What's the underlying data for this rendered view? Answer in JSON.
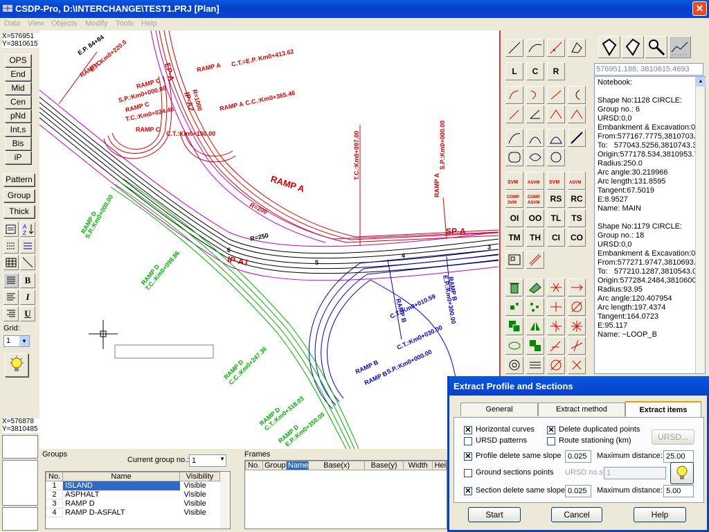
{
  "title": "CSDP-Pro, D:\\INTERCHANGE\\TEST1.PRJ [Plan]",
  "menu": [
    "Data",
    "View",
    "Objects",
    "Modify",
    "Tools",
    "Help"
  ],
  "coords_top": {
    "x": "X=576951",
    "y": "Y=3810615"
  },
  "coords_bottom": {
    "x": "X=576878",
    "y": "Y=3810485"
  },
  "snap_buttons": [
    "OPS",
    "End",
    "Mid",
    "Cen",
    "pNd",
    "Int,s",
    "Bis",
    "iP"
  ],
  "other_buttons": [
    "Pattern",
    "Group",
    "Thick"
  ],
  "grid": {
    "label": "Grid:",
    "value": "1"
  },
  "toolbar_text": [
    "L",
    "C",
    "R",
    "RS",
    "RC",
    "OI",
    "OO",
    "TL",
    "TS",
    "TM",
    "TH",
    "CI",
    "CO"
  ],
  "cursor_coords": "576951.188, 3810615.4693",
  "notebook": [
    "Notebook:",
    "",
    "Shape No:1128 CIRCLE:",
    "Group no.: 6",
    "URSD:0,0",
    "Embankment & Excavation:0,",
    "From:577167.7775,3810703.9",
    "To:   577043.5256,3810743.3",
    "Origin:577178.534,3810953.7",
    "Radius:250.0",
    "Arc angle:30.219966",
    "Arc length:131.8595",
    "Tangent:67.5019",
    "E:8.9527",
    "Name: MAIN",
    "",
    "Shape No:1179 CIRCLE:",
    "Group no.: 18",
    "URSD:0,0",
    "Embankment & Excavation:0,",
    "From:577271.9747,3810693.0",
    "To:   577210.1287,3810543.0",
    "Origin:577284.2484,3810600.",
    "Radius:93.95",
    "Arc angle:120.407954",
    "Arc length:197.4374",
    "Tangent:164.0723",
    "E:95.117",
    "Name: ~LOOP_B"
  ],
  "groups": {
    "title": "Groups",
    "current_label": "Current group no.:",
    "current": "1",
    "headers": [
      "No.",
      "Name",
      "Visibility"
    ],
    "rows": [
      [
        "1",
        "ISLAND",
        "Visible"
      ],
      [
        "2",
        "ASPHALT",
        "Visible"
      ],
      [
        "3",
        "RAMP D",
        "Visible"
      ],
      [
        "4",
        "RAMP D-ASFALT",
        "Visible"
      ]
    ]
  },
  "frames": {
    "title": "Frames",
    "headers": [
      "No.",
      "Group",
      "Name",
      "Base(x)",
      "Base(y)",
      "Width",
      "Hei"
    ]
  },
  "dialog": {
    "title": "Extract Profile and Sections",
    "tabs": [
      "General",
      "Extract method",
      "Extract items"
    ],
    "hcurves": "Horizontal curves",
    "dupes": "Delete duplicated points",
    "ursd_patterns": "URSD patterns",
    "route_station": "Route stationing (km)",
    "ursd_btn": "URSD...",
    "profile_slope": "Profile delete same slope",
    "profile_slope_val": "0.025",
    "maxdist": "Maximum distance:",
    "profile_max": "25.00",
    "ground": "Ground sections points",
    "ursd_nos": "URSD no.s:",
    "ursd_nos_val": "1",
    "section_slope": "Section delete same slope",
    "section_slope_val": "0.025",
    "section_max": "5.00",
    "start": "Start",
    "cancel": "Cancel",
    "help": "Help"
  },
  "drawing_labels": {
    "ep": "E.P. 84+84",
    "rampc1": "RAMP C",
    "rampc1b": "E.P. Km0+220.0",
    "epa": "EP-A",
    "rampa1": "RAMP A",
    "rampa1b": "C.T.=E.P. Km0+413.62",
    "rampc2": "RAMP C",
    "rampc2b": "S.P.:Km0+000.00",
    "r1000": "R=1000",
    "ipa2": "IP-A2",
    "rampa2": "RAMP A",
    "rampa2b": "C.C.:Km0+365.46",
    "rampc3": "RAMP C",
    "rampc3b": "T.C.:Km0+024.46",
    "rampc4": "RAMP C",
    "rampc4b": "C.T.:Km0+150.00",
    "tc097": "T.C.:Km0+097.00",
    "rampa3": "RAMP A",
    "rampa3b": "S.P.:Km0+000.00",
    "rampa_big": "RAMP A",
    "r200": "R=200",
    "r250": "R=250",
    "spa": "SP-A",
    "ipa1": "IP-A1",
    "rampd1": "RAMP D",
    "rampd1b": "S.P.:Km0+000.00",
    "rampd2": "RAMP D",
    "rampd2b": "T.C.:Km0+098.86",
    "rampd3": "RAMP D",
    "rampd3b": "C.C.:Km0+247.36",
    "rampd4": "RAMP D",
    "rampd4b": "C.T.:Km0+318.03",
    "rampd5": "RAMP D",
    "rampd5b": "E.P.:Km0+350.00",
    "rampb1": "RAMP B",
    "rampb1b": "C.T.:Km0+010.59",
    "rampb2": "RAMP B",
    "rampb2b": "E.P.:Km0+300.00",
    "rampb3": "RAMP B",
    "rampb3b": "C.T.:Km0+030.00",
    "rampb4": "RAMP B",
    "rampb4b": "S.P.:Km0+000.00",
    "n3": "3",
    "n4": "4",
    "n5": "5",
    "n6": "6"
  }
}
